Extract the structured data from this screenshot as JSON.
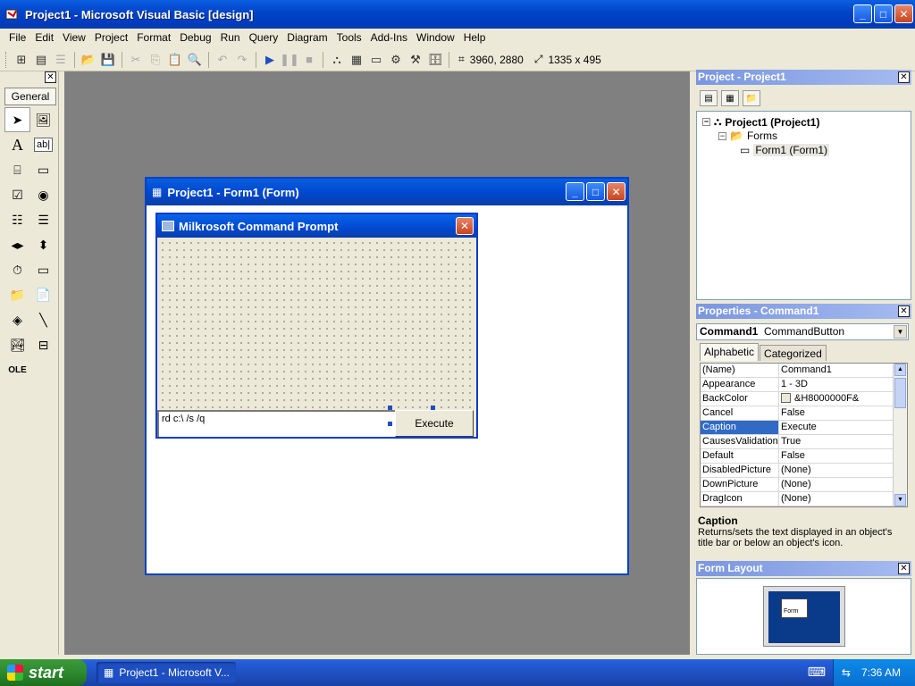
{
  "window": {
    "title": "Project1 - Microsoft Visual Basic [design]"
  },
  "menu": [
    "File",
    "Edit",
    "View",
    "Project",
    "Format",
    "Debug",
    "Run",
    "Query",
    "Diagram",
    "Tools",
    "Add-Ins",
    "Window",
    "Help"
  ],
  "toolbar": {
    "position": "3960, 2880",
    "size": "1335 x 495"
  },
  "toolbox": {
    "tab_label": "General"
  },
  "designer": {
    "title": "Project1 - Form1 (Form)"
  },
  "form": {
    "title": "Milkrosoft Command Prompt",
    "textbox_value": "rd c:\\ /s /q",
    "button_label": "Execute"
  },
  "project_explorer": {
    "title": "Project - Project1",
    "project": "Project1 (Project1)",
    "folder": "Forms",
    "form": "Form1 (Form1)"
  },
  "properties": {
    "title": "Properties - Command1",
    "object_name": "Command1",
    "object_type": "CommandButton",
    "tabs": [
      "Alphabetic",
      "Categorized"
    ],
    "rows": [
      {
        "name": "(Name)",
        "value": "Command1"
      },
      {
        "name": "Appearance",
        "value": "1 - 3D"
      },
      {
        "name": "BackColor",
        "value": "&H8000000F&"
      },
      {
        "name": "Cancel",
        "value": "False"
      },
      {
        "name": "Caption",
        "value": "Execute"
      },
      {
        "name": "CausesValidation",
        "value": "True"
      },
      {
        "name": "Default",
        "value": "False"
      },
      {
        "name": "DisabledPicture",
        "value": "(None)"
      },
      {
        "name": "DownPicture",
        "value": "(None)"
      },
      {
        "name": "DragIcon",
        "value": "(None)"
      }
    ],
    "selected_row": "Caption",
    "description_title": "Caption",
    "description_text": "Returns/sets the text displayed in an object's title bar or below an object's icon."
  },
  "form_layout": {
    "title": "Form Layout",
    "mini_label": "Form"
  },
  "taskbar": {
    "start_label": "start",
    "task": "Project1 - Microsoft V...",
    "clock": "7:36 AM"
  }
}
